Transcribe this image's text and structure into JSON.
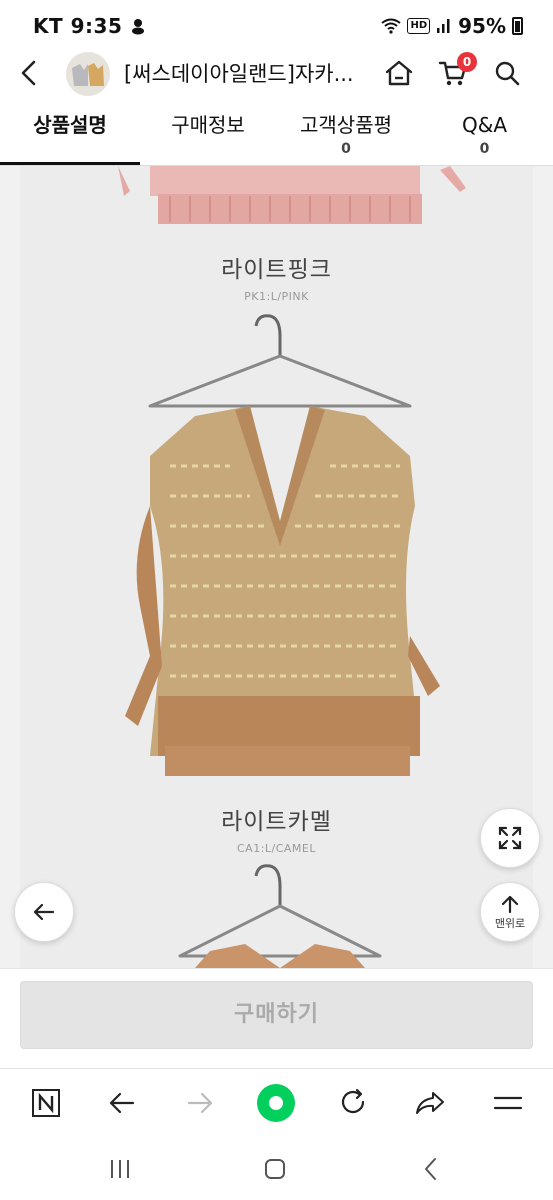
{
  "status_bar": {
    "carrier": "KT",
    "time": "9:35",
    "network": "HD",
    "battery": "95%"
  },
  "header": {
    "title": "[써스데이아일랜드]자카...",
    "cart_count": "0",
    "icons": [
      "back-arrow-icon",
      "home-icon",
      "cart-icon",
      "search-icon"
    ]
  },
  "tabs": [
    {
      "label": "상품설명",
      "count": ""
    },
    {
      "label": "구매정보",
      "count": ""
    },
    {
      "label": "고객상품평",
      "count": "0"
    },
    {
      "label": "Q&A",
      "count": "0"
    }
  ],
  "products": [
    {
      "name": "라이트핑크",
      "code": "PK1:L/PINK",
      "color": "#e8b4b0"
    },
    {
      "name": "라이트카멜",
      "code": "CA1:L/CAMEL",
      "color": "#c9946a"
    }
  ],
  "floating": {
    "expand_icon": "expand-arrows-icon",
    "top_label": "맨위로",
    "back_icon": "left-arrow-icon"
  },
  "buy_bar": {
    "button_label": "구매하기"
  },
  "browser_toolbar": {
    "icons": [
      "naver-n-icon",
      "back-icon",
      "forward-icon",
      "green-dot-icon",
      "reload-icon",
      "share-icon",
      "menu-icon"
    ]
  },
  "system_nav": {
    "icons": [
      "recents-icon",
      "home-icon",
      "back-icon"
    ]
  }
}
